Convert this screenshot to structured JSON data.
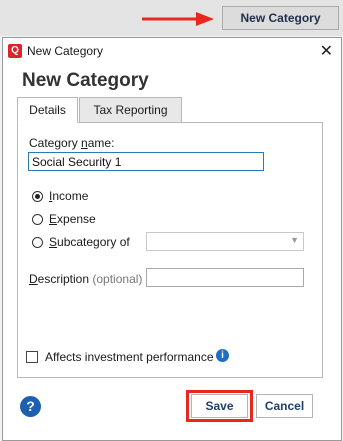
{
  "background": {
    "new_category_button_label": "New Category"
  },
  "dialog": {
    "window_title": "New Category",
    "heading": "New Category",
    "tabs": [
      {
        "label": "Details",
        "active": true
      },
      {
        "label": "Tax Reporting",
        "active": false
      }
    ],
    "category_name": {
      "label_pre": "Category ",
      "label_underlined": "n",
      "label_post": "ame:",
      "value": "Social Security 1"
    },
    "radios": [
      {
        "u": "I",
        "rest": "ncome",
        "checked": true
      },
      {
        "u": "E",
        "rest": "xpense",
        "checked": false
      },
      {
        "u": "S",
        "rest": "ubcategory of",
        "checked": false
      }
    ],
    "subcategory_value": "",
    "description": {
      "u": "D",
      "rest": "escription",
      "optional": "(optional)",
      "value": ""
    },
    "affects_investment_label": "Affects investment performance",
    "affects_investment_checked": false,
    "save_label": "Save",
    "cancel_label": "Cancel"
  },
  "colors": {
    "annotation_red": "#e8281e",
    "accent_blue": "#1e6fc2",
    "app_icon_red": "#d9262c"
  },
  "icons": {
    "app": "quicken-q-icon",
    "close": "close-icon",
    "info": "info-icon",
    "help": "help-icon",
    "dropdown": "chevron-down-icon",
    "annotation": "red-arrow-icon"
  }
}
